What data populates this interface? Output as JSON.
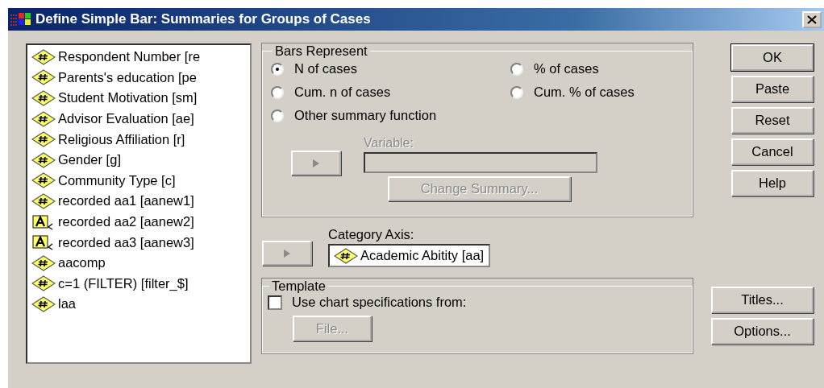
{
  "window": {
    "title": "Define Simple Bar: Summaries for Groups of Cases"
  },
  "variables": [
    {
      "label": "Respondent Number [re",
      "kind": "numeric",
      "selected": false
    },
    {
      "label": "Parents's education [pe",
      "kind": "numeric",
      "selected": false
    },
    {
      "label": "Student Motivation [sm]",
      "kind": "numeric",
      "selected": false
    },
    {
      "label": "Advisor Evaluation [ae]",
      "kind": "numeric",
      "selected": false
    },
    {
      "label": "Religious Affiliation [r]",
      "kind": "numeric",
      "selected": false
    },
    {
      "label": "Gender [g]",
      "kind": "numeric",
      "selected": false
    },
    {
      "label": "Community Type [c]",
      "kind": "numeric",
      "selected": false
    },
    {
      "label": "recorded aa1 [aanew1]",
      "kind": "numeric",
      "selected": false
    },
    {
      "label": "recorded aa2 [aanew2]",
      "kind": "string",
      "selected": false
    },
    {
      "label": "recorded aa3 [aanew3]",
      "kind": "string",
      "selected": false
    },
    {
      "label": "aacomp",
      "kind": "numeric",
      "selected": false
    },
    {
      "label": "c=1 (FILTER) [filter_$]",
      "kind": "numeric",
      "selected": false
    },
    {
      "label": "laa",
      "kind": "numeric",
      "selected": false
    }
  ],
  "bars_represent": {
    "title": "Bars Represent",
    "options": [
      {
        "label": "N of cases",
        "selected": true
      },
      {
        "label": "% of cases",
        "selected": false
      },
      {
        "label": "Cum. n of cases",
        "selected": false
      },
      {
        "label": "Cum. % of cases",
        "selected": false
      },
      {
        "label": "Other summary function",
        "selected": false
      }
    ],
    "variable": {
      "label": "Variable:",
      "disabled": true
    },
    "move_button": {
      "disabled": true
    },
    "change_summary_button": {
      "label": "Change Summary...",
      "disabled": true
    }
  },
  "category_axis": {
    "label": "Category Axis:",
    "move_button": {
      "disabled": true
    },
    "value": {
      "label": "Academic Abitity [aa]",
      "kind": "numeric"
    }
  },
  "template": {
    "title": "Template",
    "checkbox": {
      "label": "Use chart specifications from:",
      "checked": false
    },
    "file_button": {
      "label": "File...",
      "disabled": true
    }
  },
  "buttons": [
    {
      "label": "OK",
      "default": true
    },
    {
      "label": "Paste",
      "default": false
    },
    {
      "label": "Reset",
      "default": false
    },
    {
      "label": "Cancel",
      "default": false
    },
    {
      "label": "Help",
      "default": false
    }
  ],
  "side_buttons": [
    {
      "label": "Titles..."
    },
    {
      "label": "Options..."
    }
  ]
}
